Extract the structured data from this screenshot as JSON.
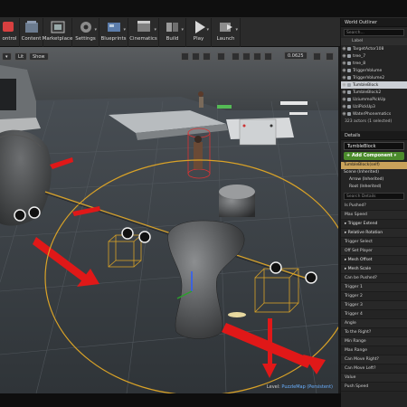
{
  "toolbar": {
    "items": [
      {
        "label": "Content",
        "icon": "content-icon"
      },
      {
        "label": "Marketplace",
        "icon": "marketplace-icon"
      },
      {
        "label": "Settings",
        "icon": "gear-icon"
      },
      {
        "label": "Blueprints",
        "icon": "blueprint-icon"
      },
      {
        "label": "Cinematics",
        "icon": "cinematics-icon"
      },
      {
        "label": "Build",
        "icon": "build-icon"
      },
      {
        "label": "Play",
        "icon": "play-icon"
      },
      {
        "label": "Launch",
        "icon": "launch-icon"
      }
    ],
    "first_partial_label": "ontrol"
  },
  "viewport": {
    "buttons": {
      "lit": "Lit",
      "show": "Show"
    },
    "snap_value": "0.0625",
    "status_label": "Level:",
    "status_value": "PuzzleMap (Persistent)"
  },
  "world_outliner": {
    "tab": "World Outliner",
    "search_placeholder": "Search...",
    "column_label": "Label",
    "rows": [
      {
        "label": "TargetActor108",
        "selected": false
      },
      {
        "label": "tree_7",
        "selected": false
      },
      {
        "label": "tree_8",
        "selected": false
      },
      {
        "label": "TriggerVolume",
        "selected": false
      },
      {
        "label": "TriggerVolume2",
        "selected": false
      },
      {
        "label": "TumbleBlock",
        "selected": true
      },
      {
        "label": "TumbleBlock2",
        "selected": false
      },
      {
        "label": "UziummoPickUp",
        "selected": false
      },
      {
        "label": "UziPickUp3",
        "selected": false
      },
      {
        "label": "WaterPhonematics",
        "selected": false
      }
    ],
    "count": "323 actors (1 selected)"
  },
  "details": {
    "tab": "Details",
    "name_value": "TumbleBlock",
    "add_component": "+ Add Component ▾",
    "components": [
      {
        "label": "TumbleBlock(self)",
        "selected": true,
        "indent": false
      },
      {
        "label": "Scene (Inherited)",
        "selected": false,
        "indent": false
      },
      {
        "label": "Arrow (Inherited)",
        "selected": false,
        "indent": true
      },
      {
        "label": "Root (Inherited)",
        "selected": false,
        "indent": true
      }
    ],
    "search_placeholder": "Search Details",
    "properties": [
      "Is Pushed?",
      "Max Speed",
      "Trigger Extend",
      "Relative Rotation",
      "Trigger Select",
      "Off Set Player",
      "Mesh Offset",
      "Mesh Scale",
      "Can be Pushed?",
      "Trigger 1",
      "Trigger 2",
      "Trigger 3",
      "Trigger 4",
      "Angle",
      "To the Right?",
      "Min Range",
      "Max Range",
      "Can Move Right?",
      "Can Move Left?",
      "Value",
      "Push Speed"
    ]
  },
  "colors": {
    "accent_selection": "#c9a25a",
    "add_component_green": "#4b8b2c",
    "gizmo_red": "#e01818",
    "spline_orange": "#d9a227"
  }
}
